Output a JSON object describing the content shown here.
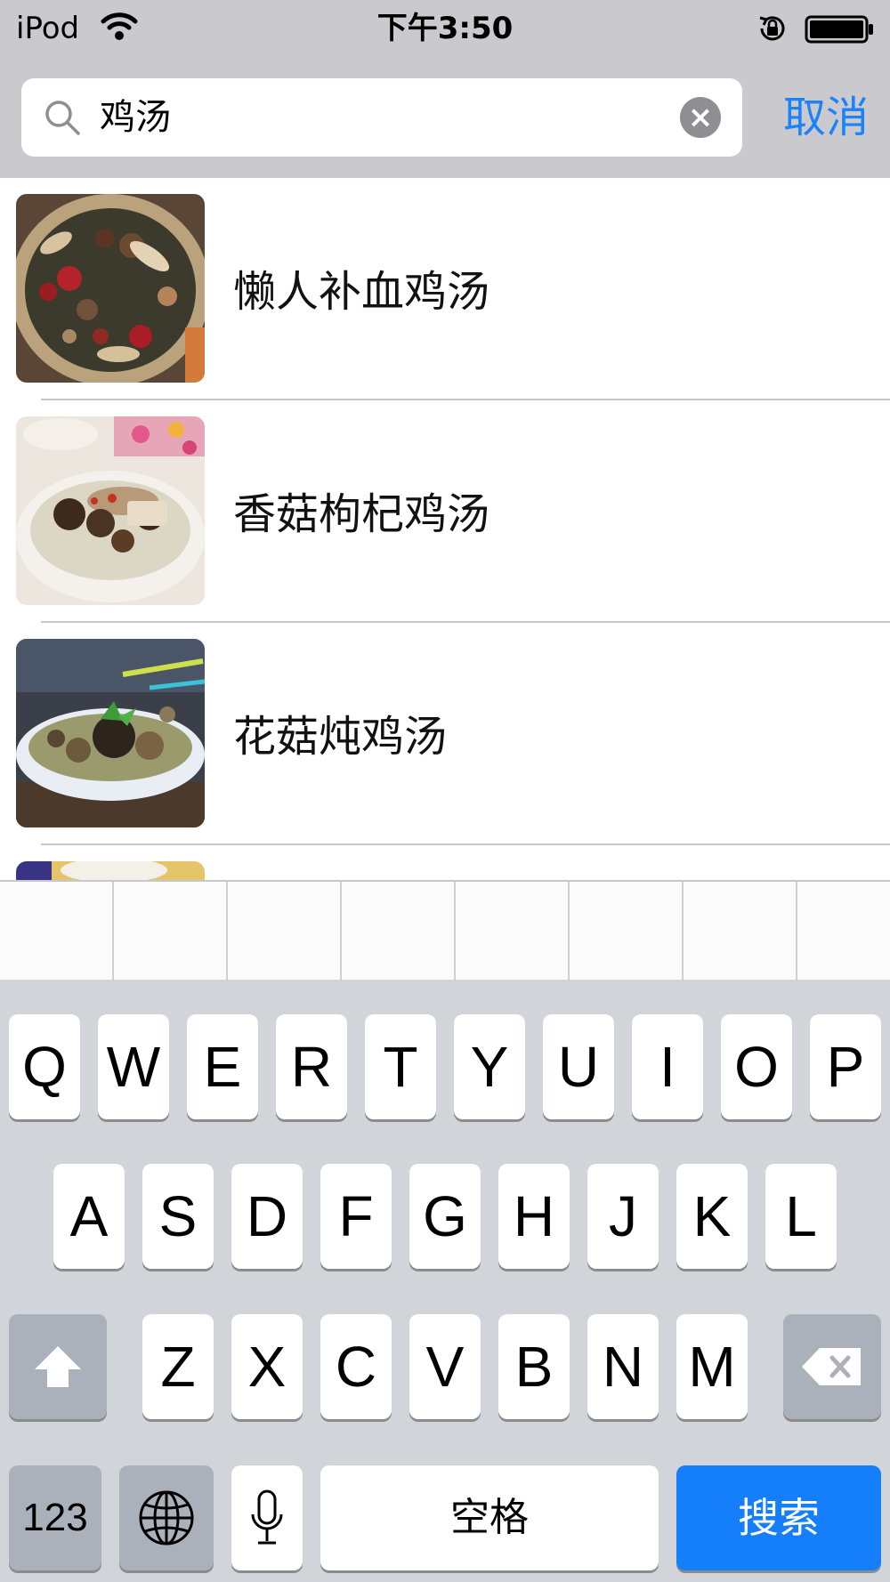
{
  "status_bar": {
    "carrier": "iPod",
    "time": "下午3:50",
    "icons": [
      "wifi-icon",
      "rotation-lock-icon",
      "battery-icon"
    ]
  },
  "search": {
    "query": "鸡汤",
    "cancel_label": "取消",
    "icons": [
      "search-icon",
      "clear-icon"
    ]
  },
  "results": [
    {
      "title": "懒人补血鸡汤"
    },
    {
      "title": "香菇枸杞鸡汤"
    },
    {
      "title": "花菇炖鸡汤"
    },
    {
      "title": ""
    }
  ],
  "keyboard": {
    "row1": [
      "Q",
      "W",
      "E",
      "R",
      "T",
      "Y",
      "U",
      "I",
      "O",
      "P"
    ],
    "row2": [
      "A",
      "S",
      "D",
      "F",
      "G",
      "H",
      "J",
      "K",
      "L"
    ],
    "row3": [
      "Z",
      "X",
      "C",
      "V",
      "B",
      "N",
      "M"
    ],
    "numbers_label": "123",
    "space_label": "空格",
    "search_label": "搜索",
    "icons": [
      "shift-icon",
      "delete-icon",
      "globe-icon",
      "microphone-icon"
    ],
    "accent_color": "#147efb"
  },
  "colors": {
    "header_bg": "#c9c9ce",
    "cancel_text": "#1a82fb",
    "keyboard_bg": "#d1d4d9"
  }
}
